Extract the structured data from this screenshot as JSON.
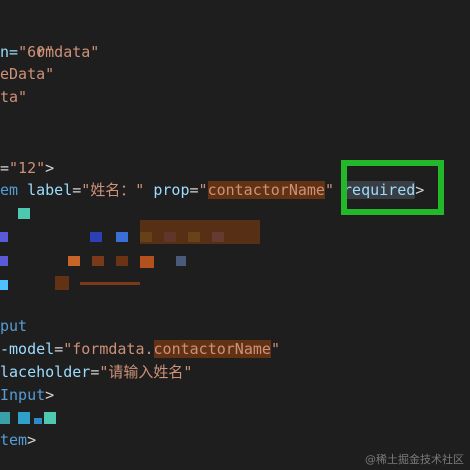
{
  "editor": {
    "lines": {
      "l1": {
        "frag": "rmdata\""
      },
      "l2_a": "n=",
      "l2_s": "\"60\"",
      "l3": "eData\"",
      "l4": "ta\"",
      "l7_a": "=",
      "l7_s": "\"12\"",
      "l7_p": ">",
      "l8_tag": "em",
      "l8_attr": "label",
      "l8_eq": "=",
      "l8_label_value": "\"姓名：\"",
      "l8_prop_attr": "prop",
      "l8_eq2": "=",
      "l8_q1": "\"",
      "l8_prop_value": "contactorName",
      "l8_q2": "\"",
      "l8_required": "required",
      "l8_close": ">",
      "l14_tag": "put",
      "l15_attr": "-model",
      "l15_eq": "=",
      "l15_s1": "\"formdata.",
      "l15_s2": "contactorName",
      "l15_s3": "\"",
      "l16_attr": "laceholder",
      "l16_eq": "=",
      "l16_s": "\"请输入姓名\"",
      "l17_tag": "Input",
      "l17_close": ">",
      "l19_tag": "tem",
      "l19_close": ">"
    },
    "colors": {
      "background": "#1e1e1e",
      "string": "#ce9178",
      "tag": "#569cd6",
      "attribute": "#9cdcfe",
      "highlight_box": "#22b82a"
    }
  },
  "watermark": "@稀土掘金技术社区"
}
